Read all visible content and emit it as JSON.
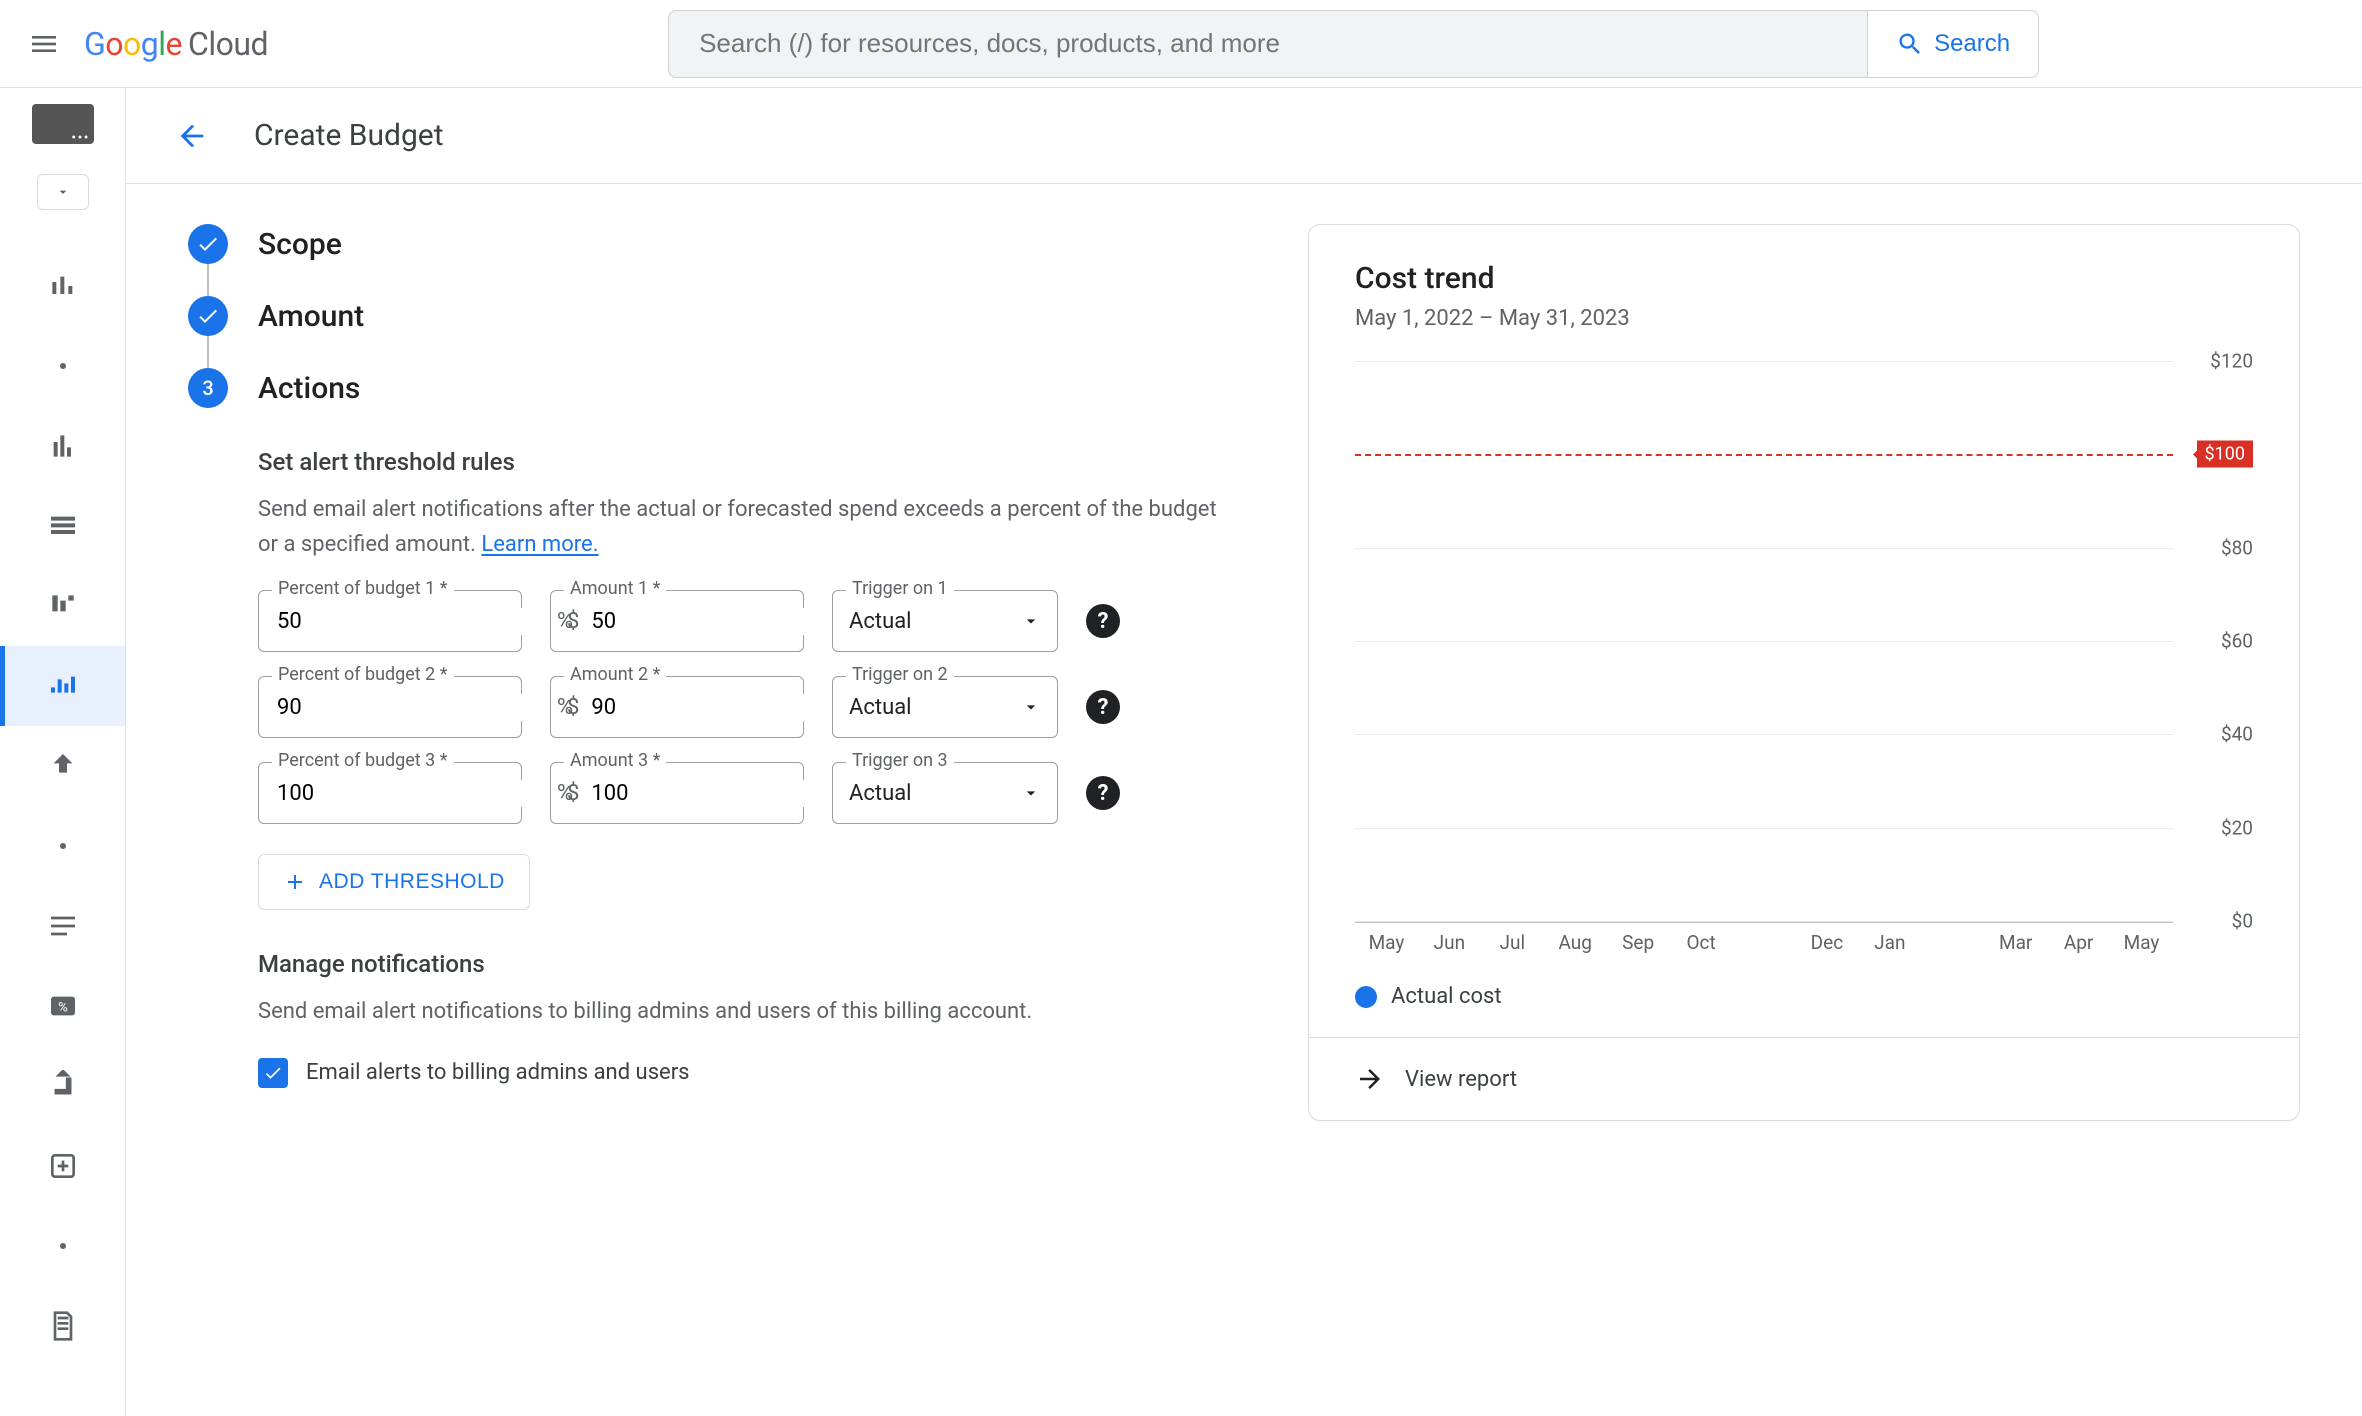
{
  "header": {
    "search_placeholder": "Search (/) for resources, docs, products, and more",
    "search_button": "Search",
    "logo_cloud": "Cloud"
  },
  "page": {
    "title": "Create Budget"
  },
  "steps": {
    "scope": "Scope",
    "amount": "Amount",
    "actions": "Actions",
    "actions_number": "3"
  },
  "alerts": {
    "heading": "Set alert threshold rules",
    "desc_a": "Send email alert notifications after the actual or forecasted spend exceeds a percent of the budget or a specified amount. ",
    "learn_more": "Learn more.",
    "labels": {
      "pct1": "Percent of budget 1 *",
      "amt1": "Amount 1 *",
      "trg1": "Trigger on 1",
      "pct2": "Percent of budget 2 *",
      "amt2": "Amount 2 *",
      "trg2": "Trigger on 2",
      "pct3": "Percent of budget 3 *",
      "amt3": "Amount 3 *",
      "trg3": "Trigger on 3"
    },
    "rows": [
      {
        "pct": "50",
        "amt": "50",
        "trigger": "Actual"
      },
      {
        "pct": "90",
        "amt": "90",
        "trigger": "Actual"
      },
      {
        "pct": "100",
        "amt": "100",
        "trigger": "Actual"
      }
    ],
    "pct_suffix": "%",
    "amt_prefix": "$",
    "add_threshold": "ADD THRESHOLD"
  },
  "notifications": {
    "heading": "Manage notifications",
    "desc": "Send email alert notifications to billing admins and users of this billing account.",
    "email_alerts_label": "Email alerts to billing admins and users"
  },
  "card": {
    "title": "Cost trend",
    "subtitle": "May 1, 2022 – May 31, 2023",
    "view_report": "View report",
    "legend_actual": "Actual cost",
    "budget_label": "$100"
  },
  "chart_data": {
    "type": "bar",
    "title": "Cost trend",
    "xlabel": "",
    "ylabel": "",
    "ylim": [
      0,
      120
    ],
    "yticks": [
      0,
      20,
      40,
      60,
      80,
      120
    ],
    "ytick_labels": [
      "$0",
      "$20",
      "$40",
      "$60",
      "$80",
      "$120"
    ],
    "budget_line": 100,
    "categories": [
      "May",
      "Jun",
      "Jul",
      "Aug",
      "Sep",
      "Oct",
      "",
      "Dec",
      "Jan",
      "",
      "Mar",
      "Apr",
      "May"
    ],
    "series": [
      {
        "name": "Actual cost",
        "values": [
          0,
          0,
          0,
          0,
          0,
          0,
          0,
          0,
          0,
          0,
          0,
          0,
          0
        ]
      }
    ]
  }
}
